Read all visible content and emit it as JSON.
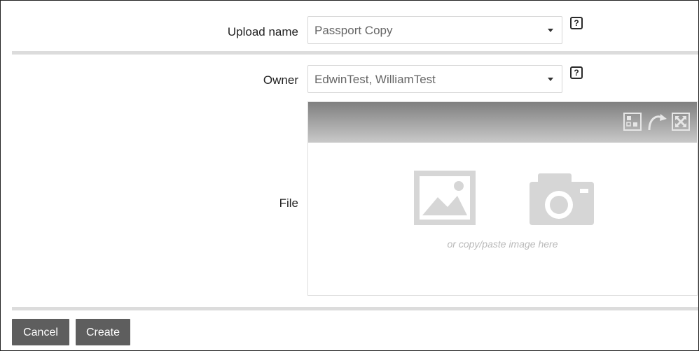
{
  "form": {
    "upload_name": {
      "label": "Upload name",
      "value": "Passport Copy",
      "help": "?"
    },
    "owner": {
      "label": "Owner",
      "value": "EdwinTest, WilliamTest",
      "help": "?"
    },
    "file": {
      "label": "File",
      "hint": "or copy/paste image here",
      "toolbar_icons": [
        "crop-icon",
        "rotate-icon",
        "expand-icon"
      ],
      "drop_icons": [
        "image-icon",
        "camera-icon"
      ]
    }
  },
  "actions": {
    "cancel_label": "Cancel",
    "create_label": "Create"
  },
  "colors": {
    "button_bg": "#5e5e5e",
    "separator": "#dcdcdc",
    "placeholder_icon": "#d6d6d6"
  }
}
